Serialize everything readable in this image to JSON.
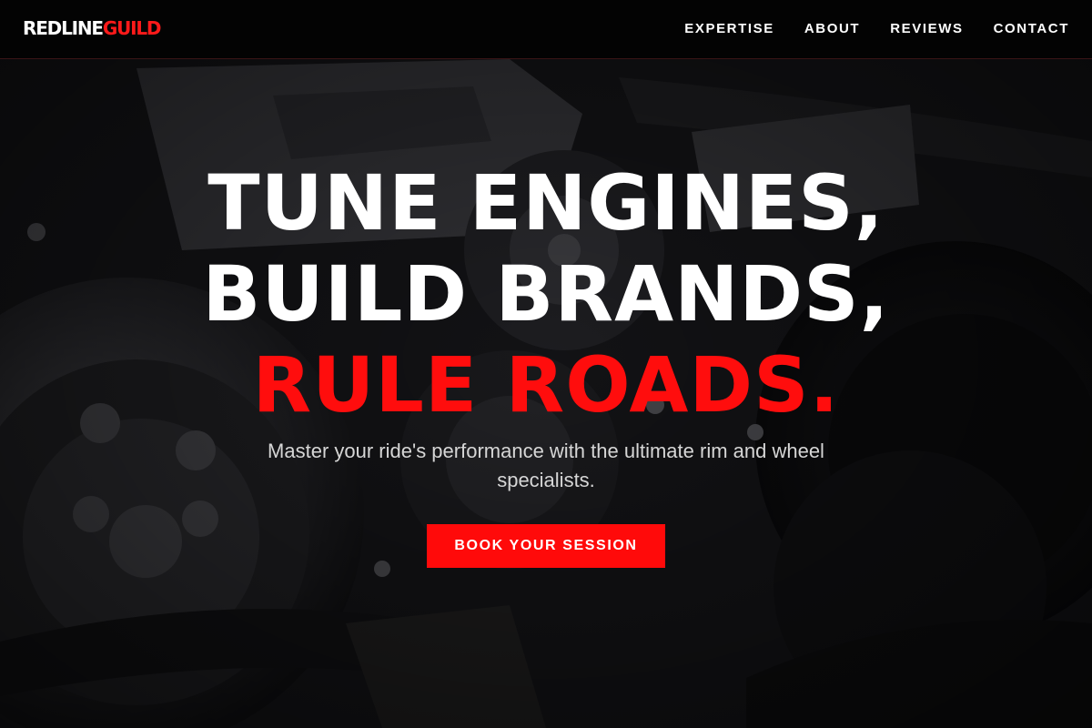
{
  "brand": {
    "name_part1": "REDLINE",
    "name_part2": "GUILD",
    "accent_color": "#ff0a0a"
  },
  "nav": {
    "items": [
      {
        "label": "EXPERTISE"
      },
      {
        "label": "ABOUT"
      },
      {
        "label": "REVIEWS"
      },
      {
        "label": "CONTACT"
      }
    ]
  },
  "hero": {
    "headline_line1": "TUNE ENGINES,",
    "headline_line2": "BUILD BRANDS,",
    "headline_line3": "RULE ROADS.",
    "subtitle": "Master your ride's performance with the ultimate rim and wheel specialists.",
    "cta_label": "BOOK YOUR SESSION",
    "background": "engine-bay-photo"
  }
}
